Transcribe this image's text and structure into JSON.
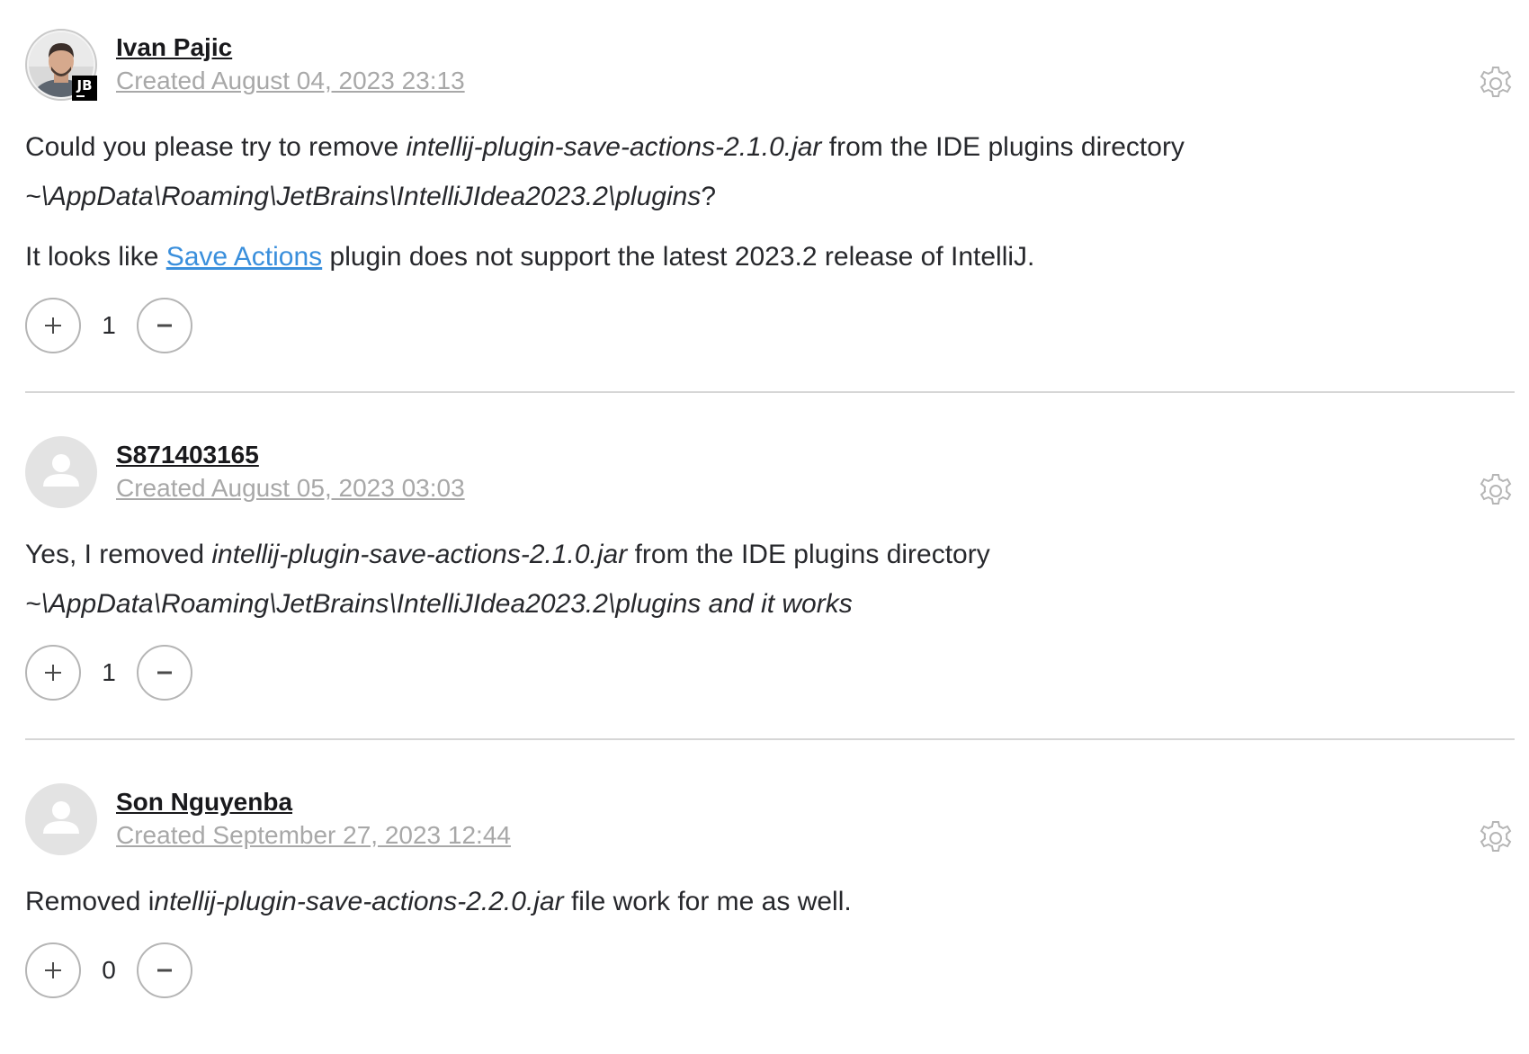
{
  "comments": [
    {
      "author": "Ivan Pajic",
      "date": "Created August 04, 2023 23:13",
      "avatar": "photo",
      "badge": "JB",
      "p1_a": "Could you please try to remove ",
      "p1_file": "intellij-plugin-save-actions-2.1.0.jar",
      "p1_b": " from the IDE plugins directory ",
      "p1_path": "~\\AppData\\Roaming\\JetBrains\\IntelliJIdea2023.2\\plugins",
      "p1_c": "?",
      "p2_a": "It looks like ",
      "p2_link": "Save Actions",
      "p2_b": " plugin does not support the latest 2023.2 release of IntelliJ.",
      "votes": "1"
    },
    {
      "author": "S871403165",
      "date": "Created August 05, 2023 03:03",
      "avatar": "placeholder",
      "p1_a": "Yes, I removed ",
      "p1_file": "intellij-plugin-save-actions-2.1.0.jar",
      "p1_b": " from the IDE plugins directory ",
      "p1_path": "~\\AppData\\Roaming\\JetBrains\\IntelliJIdea2023.2\\plugins and it works",
      "votes": "1"
    },
    {
      "author": "Son Nguyenba",
      "date": "Created September 27, 2023 12:44",
      "avatar": "placeholder",
      "p1_a": "Removed i",
      "p1_file": "ntellij-plugin-save-actions-2.2.0.jar",
      "p1_b": " file work for me as well.",
      "votes": "0"
    }
  ],
  "icons": {
    "gear": "gear-icon",
    "upvote": "plus-icon",
    "downvote": "minus-icon",
    "default_avatar": "user-silhouette-icon"
  },
  "colors": {
    "link": "#3a8fdc",
    "date": "#a8a8a8",
    "text": "#27282c",
    "divider": "#d6d6d6"
  }
}
